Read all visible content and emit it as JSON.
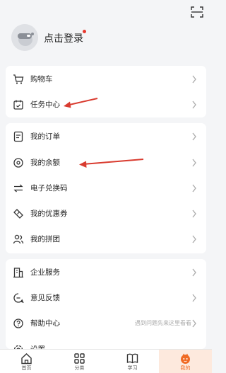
{
  "header": {
    "login_label": "点击登录"
  },
  "menu": {
    "group1": [
      {
        "label": "购物车",
        "icon": "cart-icon"
      },
      {
        "label": "任务中心",
        "icon": "task-calendar-icon"
      }
    ],
    "group2": [
      {
        "label": "我的订单",
        "icon": "order-list-icon"
      },
      {
        "label": "我的余额",
        "icon": "balance-coin-icon"
      },
      {
        "label": "电子兑换码",
        "icon": "exchange-icon"
      },
      {
        "label": "我的优惠券",
        "icon": "coupon-ticket-icon"
      },
      {
        "label": "我的拼团",
        "icon": "group-users-icon"
      }
    ],
    "group3": [
      {
        "label": "企业服务",
        "icon": "enterprise-building-icon"
      },
      {
        "label": "意见反馈",
        "icon": "feedback-icon"
      },
      {
        "label": "帮助中心",
        "icon": "help-question-icon",
        "hint": "遇到问题先来这里看看"
      },
      {
        "label": "设置",
        "icon": "settings-gear-icon"
      }
    ]
  },
  "tabbar": [
    {
      "label": "首页",
      "icon": "home-icon"
    },
    {
      "label": "分类",
      "icon": "category-grid-icon"
    },
    {
      "label": "学习",
      "icon": "study-book-icon"
    },
    {
      "label": "我的",
      "icon": "mine-avatar-icon",
      "active": true
    }
  ],
  "colors": {
    "accent": "#f06a23",
    "annotation_arrow": "#d93b2f",
    "background": "#f4f5f7"
  }
}
